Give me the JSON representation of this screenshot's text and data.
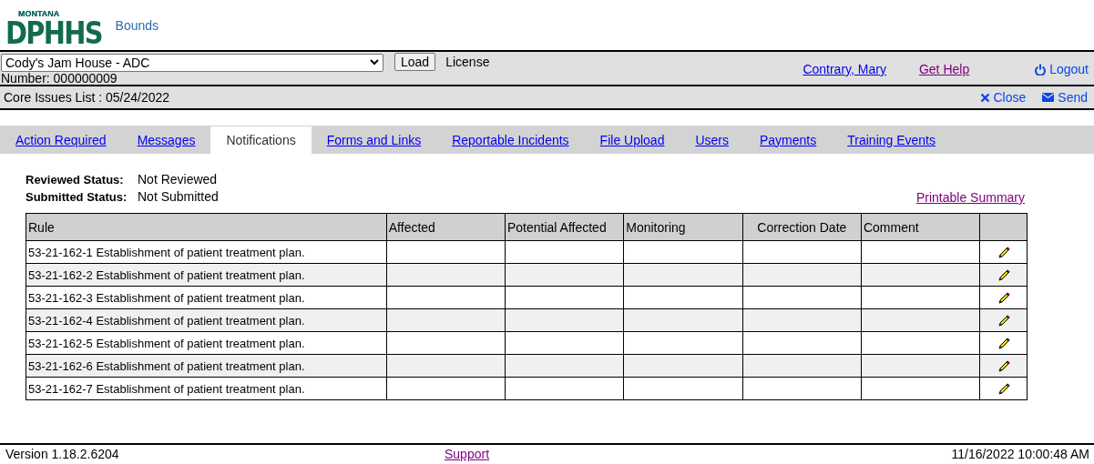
{
  "logo": {
    "top": "MONTANA",
    "main": "DPHHS",
    "app": "Bounds"
  },
  "facility": {
    "value": "Cody's Jam House - ADC",
    "load": "Load",
    "license_label": "License",
    "number": "Number: 000000009"
  },
  "user_links": [
    {
      "kind": "user",
      "label": "Contrary, Mary",
      "visited": false
    },
    {
      "kind": "help",
      "label": "Get Help",
      "visited": true
    },
    {
      "kind": "logout",
      "label": "Logout",
      "visited": false
    }
  ],
  "list_title": "Core Issues List : 05/24/2022",
  "actions": [
    {
      "kind": "close",
      "label": "Close"
    },
    {
      "kind": "send",
      "label": "Send"
    }
  ],
  "tabs": [
    {
      "label": "Action Required",
      "selected": false
    },
    {
      "label": "Messages",
      "selected": false
    },
    {
      "label": "Notifications",
      "selected": true
    },
    {
      "label": "Forms and Links",
      "selected": false
    },
    {
      "label": "Reportable Incidents",
      "selected": false
    },
    {
      "label": "File Upload",
      "selected": false
    },
    {
      "label": "Users",
      "selected": false
    },
    {
      "label": "Payments",
      "selected": false
    },
    {
      "label": "Training Events",
      "selected": false
    }
  ],
  "statuses": [
    {
      "label": "Reviewed Status:",
      "value": "Not Reviewed"
    },
    {
      "label": "Submitted Status:",
      "value": "Not Submitted"
    }
  ],
  "printable_link": {
    "label": "Printable Summary",
    "visited": true
  },
  "table": {
    "columns": [
      "Rule",
      "Affected",
      "Potential Affected",
      "Monitoring",
      "Correction Date",
      "Comment"
    ],
    "rows": [
      {
        "rule": "53-21-162-1 Establishment of patient treatment plan."
      },
      {
        "rule": "53-21-162-2 Establishment of patient treatment plan."
      },
      {
        "rule": "53-21-162-3 Establishment of patient treatment plan."
      },
      {
        "rule": "53-21-162-4 Establishment of patient treatment plan."
      },
      {
        "rule": "53-21-162-5 Establishment of patient treatment plan."
      },
      {
        "rule": "53-21-162-6 Establishment of patient treatment plan."
      },
      {
        "rule": "53-21-162-7 Establishment of patient treatment plan."
      }
    ]
  },
  "footer": {
    "version": "Version 1.18.2.6204",
    "support": {
      "label": "Support",
      "visited": true
    },
    "timestamp": "11/16/2022 10:00:48 AM"
  }
}
